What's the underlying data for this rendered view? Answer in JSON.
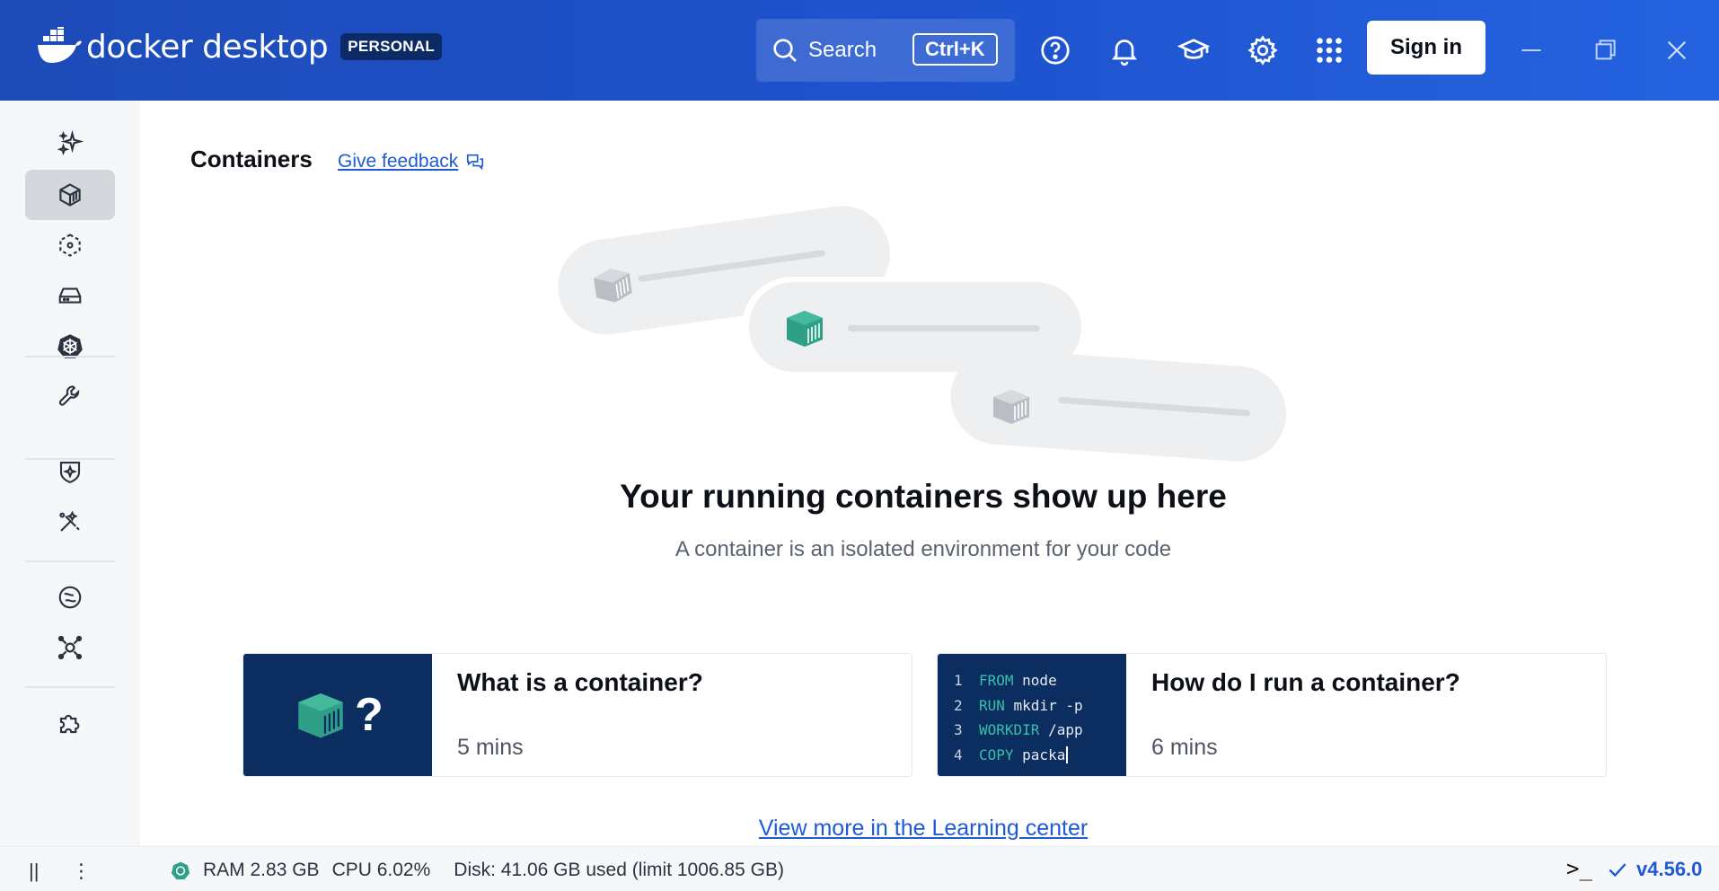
{
  "header": {
    "brand": "docker desktop",
    "plan_badge": "PERSONAL",
    "search_label": "Search",
    "search_shortcut": "Ctrl+K",
    "sign_in_label": "Sign in"
  },
  "sidebar": {
    "items": [
      {
        "icon": "sparkles-icon",
        "name": "ask-gordon"
      },
      {
        "icon": "container-icon",
        "name": "containers",
        "active": true
      },
      {
        "icon": "images-icon",
        "name": "images"
      },
      {
        "icon": "volumes-icon",
        "name": "volumes"
      },
      {
        "icon": "kubernetes-icon",
        "name": "kubernetes"
      },
      {
        "icon": "wrench-icon",
        "name": "builds"
      },
      {
        "icon": "shield-icon",
        "name": "scout"
      },
      {
        "icon": "models-icon",
        "name": "models"
      },
      {
        "icon": "hub-icon",
        "name": "docker-hub"
      },
      {
        "icon": "mcp-icon",
        "name": "mcp-toolkit"
      },
      {
        "icon": "puzzle-icon",
        "name": "extensions"
      }
    ]
  },
  "main": {
    "title": "Containers",
    "feedback_label": "Give feedback",
    "empty_title": "Your running containers show up here",
    "empty_subtitle": "A container is an isolated environment for your code",
    "cards": [
      {
        "title": "What is a container?",
        "duration": "5 mins",
        "thumb_glyph": "?"
      },
      {
        "title": "How do I run a container?",
        "duration": "6 mins",
        "code": [
          {
            "num": "1",
            "kw": "FROM",
            "rest": " node"
          },
          {
            "num": "2",
            "kw": "RUN",
            "rest": " mkdir -p"
          },
          {
            "num": "3",
            "kw": "WORKDIR",
            "rest": " /app"
          },
          {
            "num": "4",
            "kw": "COPY",
            "rest": " packa"
          }
        ]
      }
    ],
    "learning_link": "View more in the Learning center"
  },
  "footer": {
    "ram": "RAM 2.83 GB",
    "cpu": "CPU 6.02%",
    "disk": "Disk: 41.06 GB used (limit 1006.85 GB)",
    "terminal_glyph": ">_",
    "version": "v4.56.0"
  },
  "colors": {
    "header_blue": "#1f54d0",
    "accent_link": "#1e5ad6",
    "card_thumb": "#0b2d60",
    "container_green": "#2f9f87"
  }
}
